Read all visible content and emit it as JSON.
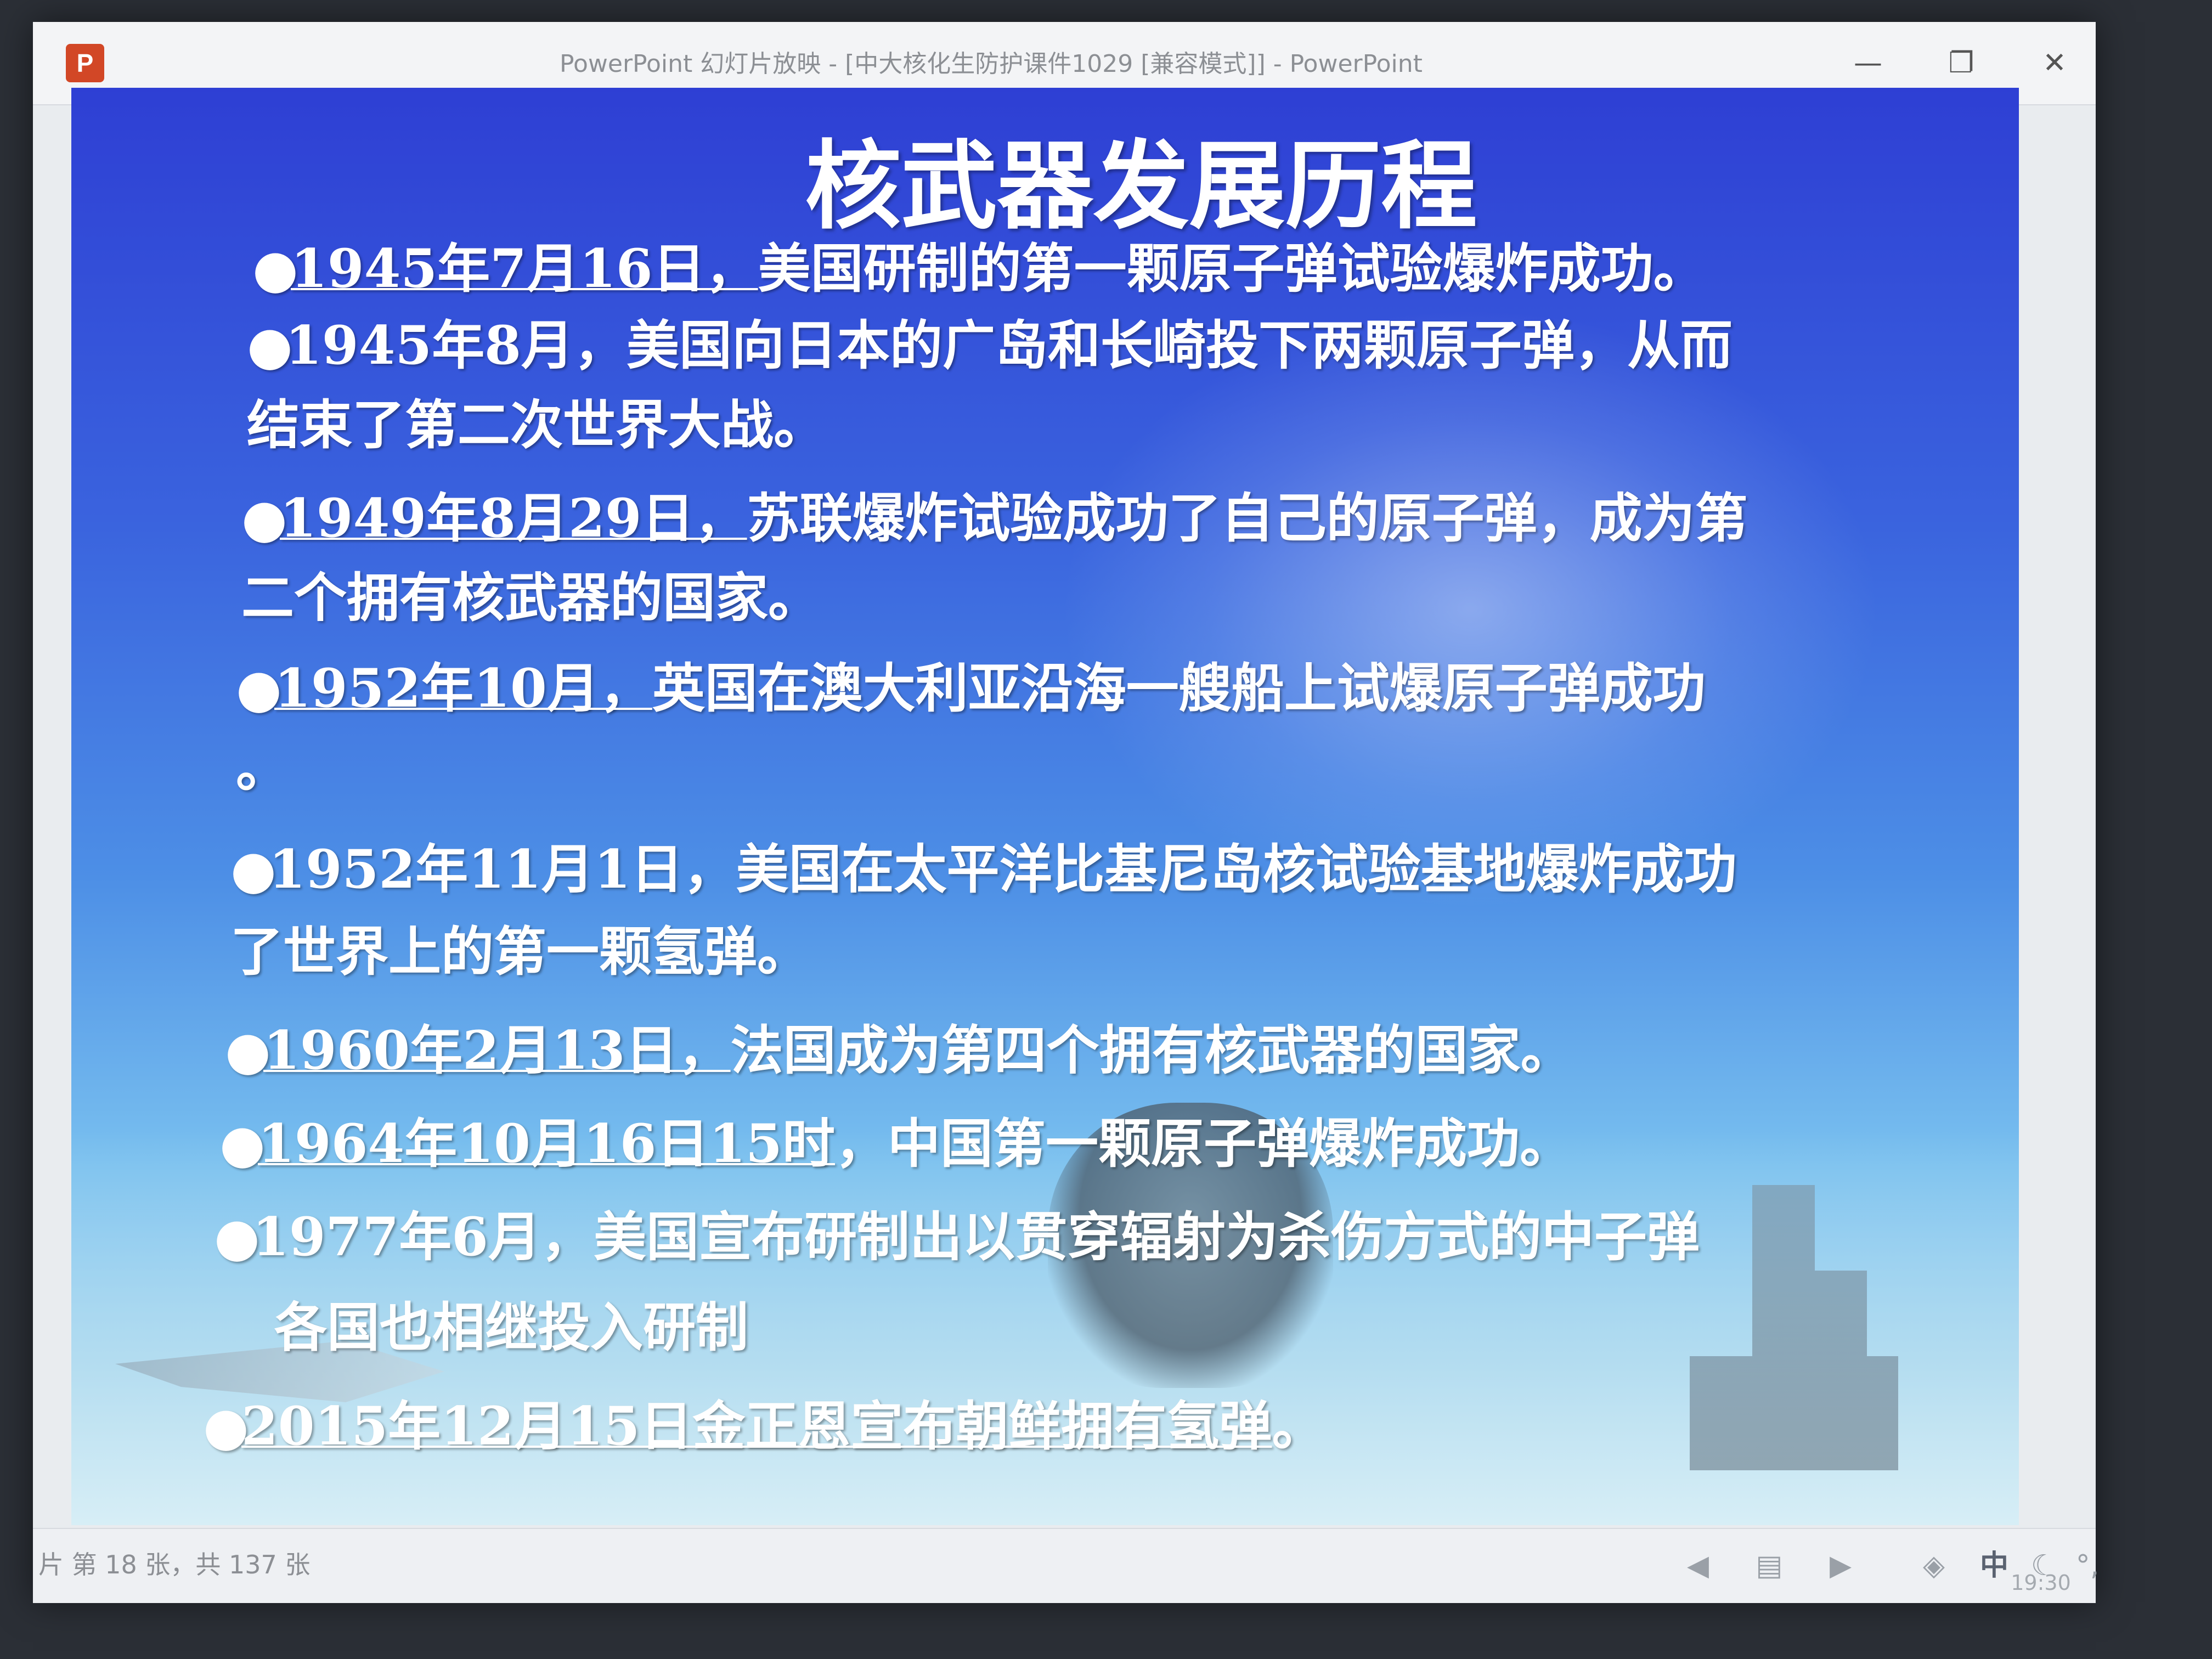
{
  "window": {
    "title": "PowerPoint 幻灯片放映 - [中大核化生防护课件1029 [兼容模式]] - PowerPoint",
    "app_icon": "P",
    "minimize_icon": "—",
    "restore_icon": "❐",
    "close_icon": "✕"
  },
  "slide": {
    "title": "核武器发展历程",
    "bullet_symbol": "●",
    "items": [
      {
        "date": "1945年7月16日，",
        "text": "美国研制的第一颗原子弹试验爆炸成功。",
        "cont": ""
      },
      {
        "date": "1945年8月，",
        "text": "美国向日本的广岛和长崎投下两颗原子弹，从而",
        "cont": "结束了第二次世界大战。"
      },
      {
        "date": "1949年8月29日，",
        "text": "苏联爆炸试验成功了自己的原子弹，成为第",
        "cont": "二个拥有核武器的国家。"
      },
      {
        "date": "1952年10月，",
        "text": "英国在澳大利亚沿海一艘船上试爆原子弹成功",
        "cont": "。"
      },
      {
        "date": "1952年11月1日，",
        "text": "美国在太平洋比基尼岛核试验基地爆炸成功",
        "cont": "了世界上的第一颗氢弹。"
      },
      {
        "date": "1960年2月13日，",
        "text": "法国成为第四个拥有核武器的国家。",
        "cont": ""
      },
      {
        "date": "1964年10月16日15时",
        "text": "，中国第一颗原子弹爆炸成功。",
        "cont": ""
      },
      {
        "date": "1977年6月，",
        "text": "美国宣布研制出以贯穿辐射为杀伤方式的中子弹",
        "cont": "各国也相继投入研制"
      },
      {
        "date": "2015年12月15日金正恩宣布朝鲜拥有氢弹",
        "text": "。",
        "cont": ""
      }
    ]
  },
  "statusbar": {
    "slide_counter": "片 第 18 张，共 137 张",
    "prev_icon": "◀",
    "menu_icon": "▤",
    "next_icon": "▶",
    "tray_icon": "◈",
    "ime_label": "中",
    "moon_icon": "☾",
    "dots_icon": "°,"
  },
  "clock": "19:30"
}
